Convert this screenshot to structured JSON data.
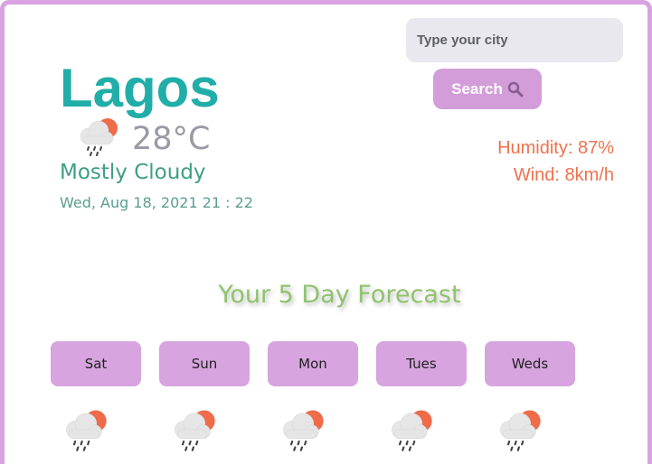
{
  "search": {
    "placeholder": "Type your city",
    "button_label": "Search"
  },
  "current": {
    "city": "Lagos",
    "temperature": "28°C",
    "condition": "Mostly Cloudy",
    "datetime": "Wed, Aug 18, 2021 21 : 22",
    "icon": "cloud-sun-rain-icon",
    "humidity": "Humidity: 87%",
    "wind": "Wind: 8km/h"
  },
  "forecast": {
    "title": "Your 5 Day Forecast",
    "days": [
      {
        "label": "Sat",
        "icon": "cloud-sun-rain-icon"
      },
      {
        "label": "Sun",
        "icon": "cloud-sun-rain-icon"
      },
      {
        "label": "Mon",
        "icon": "cloud-sun-rain-icon"
      },
      {
        "label": "Tues",
        "icon": "cloud-sun-rain-icon"
      },
      {
        "label": "Weds",
        "icon": "cloud-sun-rain-icon"
      }
    ]
  },
  "colors": {
    "frame": "#d9a2e0",
    "city": "#21ada8",
    "button": "#d39dda",
    "day_button": "#d7a4df",
    "accent_orange": "#f0724d",
    "forecast_title": "#8fc36d"
  }
}
